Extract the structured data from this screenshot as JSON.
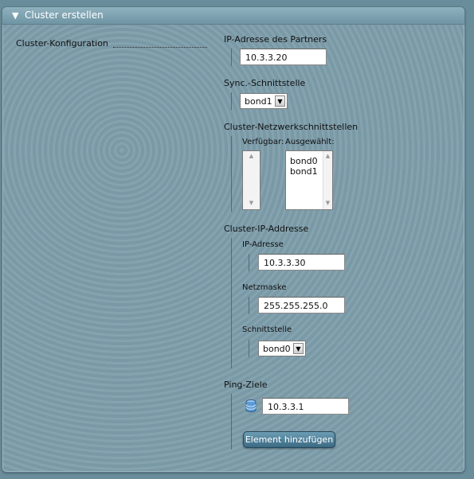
{
  "panel": {
    "title": "Cluster erstellen",
    "collapse_icon": "triangle-down-icon"
  },
  "section": {
    "label": "Cluster-Konfiguration"
  },
  "partner_ip": {
    "label": "IP-Adresse des Partners",
    "value": "10.3.3.20"
  },
  "sync_interface": {
    "label": "Sync.-Schnittstelle",
    "value": "bond1"
  },
  "cluster_net_ifaces": {
    "label": "Cluster-Netzwerkschnittstellen",
    "available_label": "Verfügbar:",
    "selected_label": "Ausgewählt:",
    "available": [],
    "selected": [
      "bond0",
      "bond1"
    ]
  },
  "cluster_ip": {
    "label": "Cluster-IP-Addresse",
    "ip_label": "IP-Adresse",
    "ip_value": "10.3.3.30",
    "mask_label": "Netzmaske",
    "mask_value": "255.255.255.0",
    "iface_label": "Schnittstelle",
    "iface_value": "bond0"
  },
  "ping": {
    "label": "Ping-Ziele",
    "icon": "database-icon",
    "value": "10.3.3.1",
    "add_button": "Element hinzufügen"
  },
  "colors": {
    "panel_bg": "#7e9eab",
    "button": "#4a7a93"
  }
}
